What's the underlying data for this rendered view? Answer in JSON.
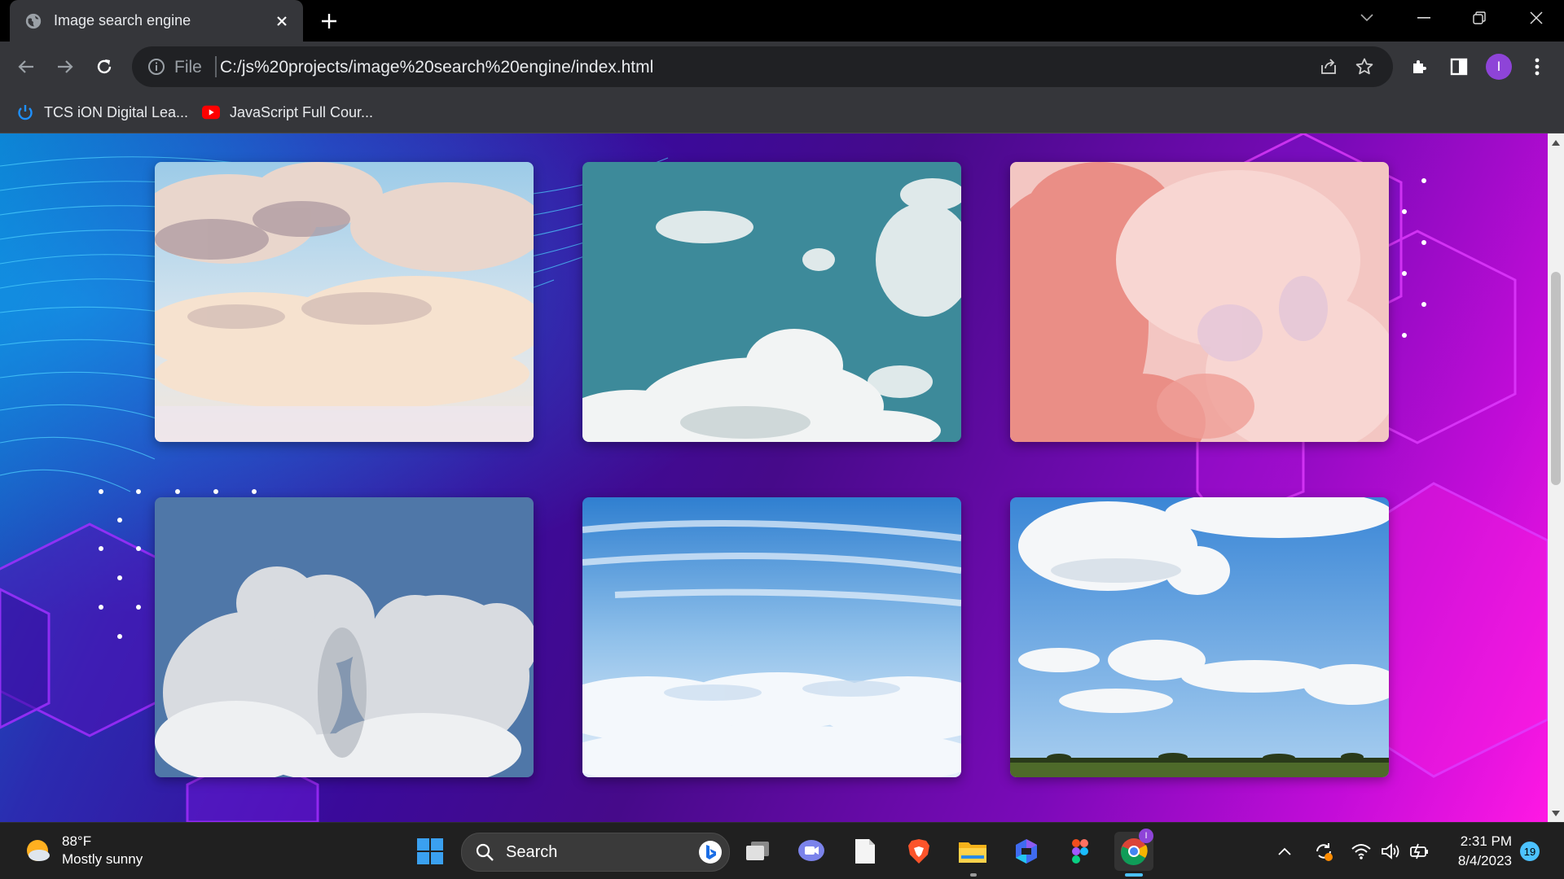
{
  "browser": {
    "tab_title": "Image search engine",
    "address_scheme": "File",
    "address_url": "C:/js%20projects/image%20search%20engine/index.html",
    "profile_initial": "I",
    "bookmarks": [
      {
        "label": "TCS iON Digital Lea...",
        "icon": "power-icon"
      },
      {
        "label": "JavaScript Full Cour...",
        "icon": "youtube-icon"
      }
    ]
  },
  "page": {
    "images": [
      {
        "alt": "clouds-1",
        "theme": "golden-cumulus"
      },
      {
        "alt": "clouds-2",
        "theme": "teal-sky"
      },
      {
        "alt": "clouds-3",
        "theme": "pink-clouds"
      },
      {
        "alt": "clouds-4",
        "theme": "grey-cumulus"
      },
      {
        "alt": "clouds-5",
        "theme": "above-clouds"
      },
      {
        "alt": "clouds-6",
        "theme": "field-sky"
      }
    ]
  },
  "taskbar": {
    "weather_temp": "88°F",
    "weather_desc": "Mostly sunny",
    "search_placeholder": "Search",
    "time": "2:31 PM",
    "date": "8/4/2023",
    "notifications": "19",
    "chrome_badge": "I"
  },
  "colors": {
    "tab_bg": "#35363a",
    "omnibox_bg": "#202124",
    "accent": "#4cc2ff",
    "page_gradient_start": "#0a76c8",
    "page_gradient_end": "#ff18e4"
  }
}
